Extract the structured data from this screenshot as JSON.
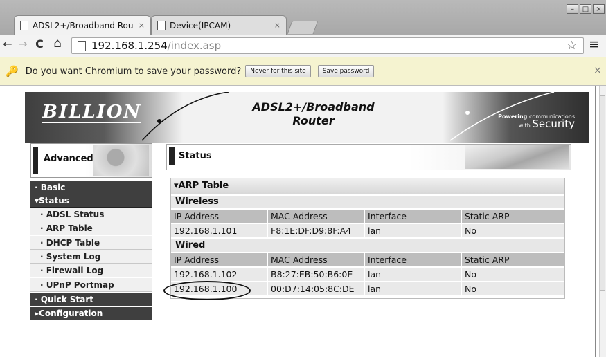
{
  "browser": {
    "tabs": [
      {
        "label": "ADSL2+/Broadband Rou",
        "close": "×"
      },
      {
        "label": "Device(IPCAM)",
        "close": "×"
      }
    ],
    "window_buttons": {
      "minimize": "–",
      "maximize": "□",
      "close": "×"
    },
    "nav": {
      "back": "←",
      "forward": "→",
      "reload": "C",
      "home": "⌂"
    },
    "url": {
      "host": "192.168.1.254",
      "path": "/index.asp"
    },
    "star": "☆",
    "menu": "≡"
  },
  "infobar": {
    "message": "Do you want Chromium to save your password?",
    "never_label": "Never for this site",
    "save_label": "Save password",
    "close": "×"
  },
  "router": {
    "logo": "BILLION",
    "title_line1": "ADSL2+/Broadband",
    "title_line2": "Router",
    "powering": "Powering",
    "communications": "communications",
    "with": "with",
    "security": "Security",
    "advanced_label": "Advanced",
    "menu": [
      {
        "label": "· Basic",
        "type": "dark"
      },
      {
        "label": "▾Status",
        "type": "dark"
      },
      {
        "label": "· ADSL Status",
        "type": "light"
      },
      {
        "label": "· ARP Table",
        "type": "light"
      },
      {
        "label": "· DHCP Table",
        "type": "light"
      },
      {
        "label": "· System Log",
        "type": "light"
      },
      {
        "label": "· Firewall Log",
        "type": "light"
      },
      {
        "label": "· UPnP Portmap",
        "type": "light"
      },
      {
        "label": "· Quick Start",
        "type": "dark"
      },
      {
        "label": "▸Configuration",
        "type": "dark"
      }
    ],
    "status_label": "Status",
    "arp_title": "▾ARP Table",
    "columns": [
      "IP Address",
      "MAC Address",
      "Interface",
      "Static ARP"
    ],
    "wireless_label": "Wireless",
    "wireless_rows": [
      [
        "192.168.1.101",
        "F8:1E:DF:D9:8F:A4",
        "lan",
        "No"
      ]
    ],
    "wired_label": "Wired",
    "wired_rows": [
      [
        "192.168.1.102",
        "B8:27:EB:50:B6:0E",
        "lan",
        "No"
      ],
      [
        "192.168.1.100",
        "00:D7:14:05:8C:DE",
        "lan",
        "No"
      ]
    ]
  }
}
